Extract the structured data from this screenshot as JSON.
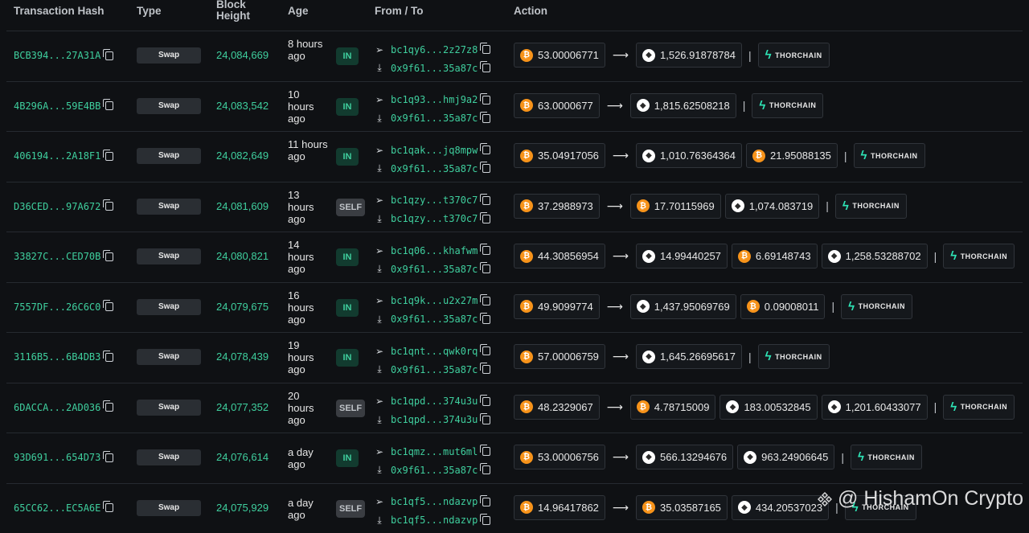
{
  "header": {
    "hash": "Transaction Hash",
    "type": "Type",
    "block": "Block Height",
    "age": "Age",
    "fromto": "From / To",
    "action": "Action"
  },
  "rows": [
    {
      "hash": "BCB394...27A31A",
      "type": "Swap",
      "block": "24,084,669",
      "age": "8 hours ago",
      "dir": "IN",
      "from": "bc1qy6...2z27z8",
      "to": "0x9f61...35a87c",
      "actions": [
        {
          "coin": "btc",
          "amt": "53.00006771"
        },
        {
          "arrow": true
        },
        {
          "coin": "eth",
          "amt": "1,526.91878784"
        }
      ],
      "protocol": "THORCHAIN"
    },
    {
      "hash": "4B296A...59E4BB",
      "type": "Swap",
      "block": "24,083,542",
      "age": "10 hours ago",
      "dir": "IN",
      "from": "bc1q93...hmj9a2",
      "to": "0x9f61...35a87c",
      "actions": [
        {
          "coin": "btc",
          "amt": "63.0000677"
        },
        {
          "arrow": true
        },
        {
          "coin": "eth",
          "amt": "1,815.62508218"
        }
      ],
      "protocol": "THORCHAIN"
    },
    {
      "hash": "406194...2A18F1",
      "type": "Swap",
      "block": "24,082,649",
      "age": "11 hours ago",
      "dir": "IN",
      "from": "bc1qak...jq8mpw",
      "to": "0x9f61...35a87c",
      "actions": [
        {
          "coin": "btc",
          "amt": "35.04917056"
        },
        {
          "arrow": true
        },
        {
          "coin": "eth",
          "amt": "1,010.76364364"
        },
        {
          "coin": "btc",
          "amt": "21.95088135"
        }
      ],
      "protocol": "THORCHAIN"
    },
    {
      "hash": "D36CED...97A672",
      "type": "Swap",
      "block": "24,081,609",
      "age": "13 hours ago",
      "dir": "SELF",
      "from": "bc1qzy...t370c7",
      "to": "bc1qzy...t370c7",
      "actions": [
        {
          "coin": "btc",
          "amt": "37.2988973"
        },
        {
          "arrow": true
        },
        {
          "coin": "btc",
          "amt": "17.70115969"
        },
        {
          "coin": "eth",
          "amt": "1,074.083719"
        }
      ],
      "protocol": "THORCHAIN"
    },
    {
      "hash": "33827C...CED70B",
      "type": "Swap",
      "block": "24,080,821",
      "age": "14 hours ago",
      "dir": "IN",
      "from": "bc1q06...khafwm",
      "to": "0x9f61...35a87c",
      "actions": [
        {
          "coin": "btc",
          "amt": "44.30856954"
        },
        {
          "arrow": true
        },
        {
          "coin": "eth",
          "amt": "14.99440257"
        },
        {
          "coin": "btc",
          "amt": "6.69148743"
        },
        {
          "coin": "eth",
          "amt": "1,258.53288702"
        }
      ],
      "protocol": "THORCHAIN"
    },
    {
      "hash": "7557DF...26C6C0",
      "type": "Swap",
      "block": "24,079,675",
      "age": "16 hours ago",
      "dir": "IN",
      "from": "bc1q9k...u2x27m",
      "to": "0x9f61...35a87c",
      "actions": [
        {
          "coin": "btc",
          "amt": "49.9099774"
        },
        {
          "arrow": true
        },
        {
          "coin": "eth",
          "amt": "1,437.95069769"
        },
        {
          "coin": "btc",
          "amt": "0.09008011"
        }
      ],
      "protocol": "THORCHAIN"
    },
    {
      "hash": "3116B5...6B4DB3",
      "type": "Swap",
      "block": "24,078,439",
      "age": "19 hours ago",
      "dir": "IN",
      "from": "bc1qnt...qwk0rq",
      "to": "0x9f61...35a87c",
      "actions": [
        {
          "coin": "btc",
          "amt": "57.00006759"
        },
        {
          "arrow": true
        },
        {
          "coin": "eth",
          "amt": "1,645.26695617"
        }
      ],
      "protocol": "THORCHAIN"
    },
    {
      "hash": "6DACCA...2AD036",
      "type": "Swap",
      "block": "24,077,352",
      "age": "20 hours ago",
      "dir": "SELF",
      "from": "bc1qpd...374u3u",
      "to": "bc1qpd...374u3u",
      "actions": [
        {
          "coin": "btc",
          "amt": "48.2329067"
        },
        {
          "arrow": true
        },
        {
          "coin": "btc",
          "amt": "4.78715009"
        },
        {
          "coin": "eth",
          "amt": "183.00532845"
        },
        {
          "coin": "eth",
          "amt": "1,201.60433077"
        }
      ],
      "protocol": "THORCHAIN"
    },
    {
      "hash": "93D691...654D73",
      "type": "Swap",
      "block": "24,076,614",
      "age": "a day ago",
      "dir": "IN",
      "from": "bc1qmz...mut6ml",
      "to": "0x9f61...35a87c",
      "actions": [
        {
          "coin": "btc",
          "amt": "53.00006756"
        },
        {
          "arrow": true
        },
        {
          "coin": "eth",
          "amt": "566.13294676"
        },
        {
          "coin": "eth",
          "amt": "963.24906645"
        }
      ],
      "protocol": "THORCHAIN"
    },
    {
      "hash": "65CC62...EC5A6E",
      "type": "Swap",
      "block": "24,075,929",
      "age": "a day ago",
      "dir": "SELF",
      "from": "bc1qf5...ndazvp",
      "to": "bc1qf5...ndazvp",
      "actions": [
        {
          "coin": "btc",
          "amt": "14.96417862"
        },
        {
          "arrow": true
        },
        {
          "coin": "btc",
          "amt": "35.03587165"
        },
        {
          "coin": "eth",
          "amt": "434.20537023"
        }
      ],
      "protocol": "THORCHAIN"
    }
  ],
  "watermark": "HishamOn Crypto",
  "colors": {
    "accent": "#3fcf9e",
    "btc": "#f7931a",
    "thor": "#2ee6b7",
    "bg": "#0f1114"
  },
  "icons": {
    "copy": "copy-icon",
    "send": "send-icon",
    "receive": "download-icon",
    "btc": "bitcoin-icon",
    "eth": "ethereum-icon",
    "thor": "thorchain-logo"
  }
}
